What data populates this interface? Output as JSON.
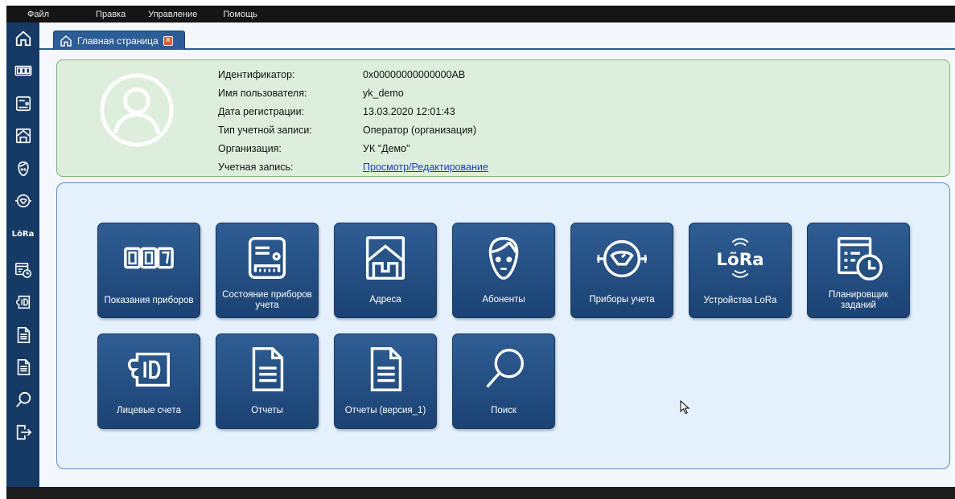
{
  "menubar": {
    "items": [
      "Файл",
      "Правка",
      "Управление",
      "Помощь"
    ]
  },
  "sidebar": {
    "items": [
      {
        "name": "home-icon"
      },
      {
        "name": "meter-readings-icon"
      },
      {
        "name": "meter-status-icon"
      },
      {
        "name": "addresses-icon"
      },
      {
        "name": "subscribers-icon"
      },
      {
        "name": "meters-icon"
      },
      {
        "name": "lora-icon",
        "text": "LõRa"
      },
      {
        "name": "scheduler-icon"
      },
      {
        "name": "accounts-icon"
      },
      {
        "name": "reports-icon"
      },
      {
        "name": "reports-v1-icon"
      },
      {
        "name": "search-icon"
      },
      {
        "name": "exit-icon"
      }
    ]
  },
  "tabs": [
    {
      "label": "Главная страница",
      "icon": "home-icon"
    }
  ],
  "profile": {
    "rows": [
      {
        "label": "Идентификатор:",
        "value": "0x00000000000000AB"
      },
      {
        "label": "Имя пользователя:",
        "value": "yk_demo"
      },
      {
        "label": "Дата регистрации:",
        "value": "13.03.2020 12:01:43"
      },
      {
        "label": "Тип учетной записи:",
        "value": "Оператор (организация)"
      },
      {
        "label": "Организация:",
        "value": "УК \"Демо\""
      },
      {
        "label": "Учетная запись:",
        "value": "Просмотр/Редактирование"
      }
    ]
  },
  "tiles": [
    {
      "label": "Показания приборов",
      "icon": "meter-readings-icon"
    },
    {
      "label": "Состояние приборов учета",
      "icon": "meter-status-icon"
    },
    {
      "label": "Адреса",
      "icon": "addresses-icon"
    },
    {
      "label": "Абоненты",
      "icon": "subscribers-icon"
    },
    {
      "label": "Приборы учета",
      "icon": "meters-icon"
    },
    {
      "label": "Устройства LoRa",
      "icon": "lora-icon",
      "icon_text": "LõRa"
    },
    {
      "label": "Планировщик заданий",
      "icon": "scheduler-icon"
    },
    {
      "label": "Лицевые счета",
      "icon": "accounts-icon",
      "icon_text": "ID"
    },
    {
      "label": "Отчеты",
      "icon": "reports-icon"
    },
    {
      "label": "Отчеты (версия_1)",
      "icon": "reports-v1-icon"
    },
    {
      "label": "Поиск",
      "icon": "search-icon"
    }
  ],
  "colors": {
    "sidebar": "#163a66",
    "tile": "#2a5586",
    "profile_bg": "#ddefdc",
    "tiles_bg": "#e4f0fb",
    "tab_close": "#e1582e"
  }
}
